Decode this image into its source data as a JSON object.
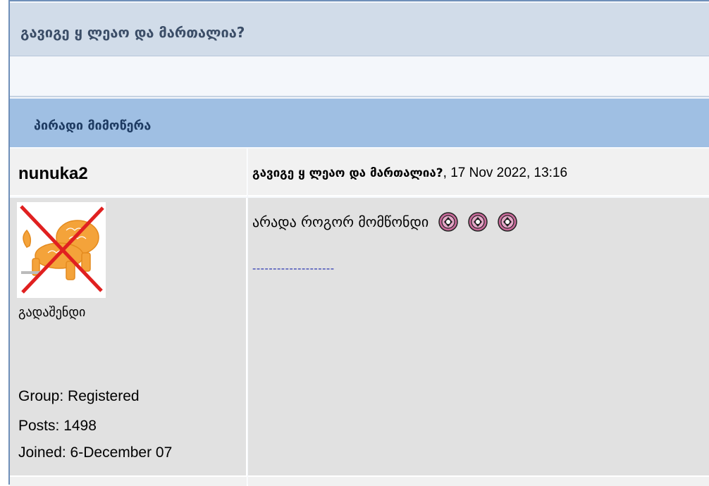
{
  "topic": {
    "title": "გავიგე ყ ლეაო და მართალია?"
  },
  "section": {
    "title": "პირადი მიმოწერა"
  },
  "post": {
    "author": "nunuka2",
    "meta_title": "გავიგე ყ ლეაო და მართალია?",
    "meta_date": ", 17 Nov 2022, 13:16",
    "body_text": "არადა როგორ მომწონდი",
    "emoticons": [
      "emoticon-icon",
      "emoticon-icon",
      "emoticon-icon"
    ],
    "signature": "--------------------"
  },
  "author_info": {
    "avatar_icon": "lion-avatar-icon",
    "rank": "გადაშენდი",
    "group": "Group: Registered",
    "posts": "Posts: 1498",
    "joined": "Joined: 6-December 07"
  },
  "colors": {
    "header_bg": "#d1dce9",
    "section_bg": "#9fbfe3",
    "cell_light": "#f1f1f1",
    "cell_dark": "#e1e1e1",
    "signature": "#2833b0",
    "avatar_cross": "#e02020",
    "avatar_lion": "#f0a030"
  }
}
